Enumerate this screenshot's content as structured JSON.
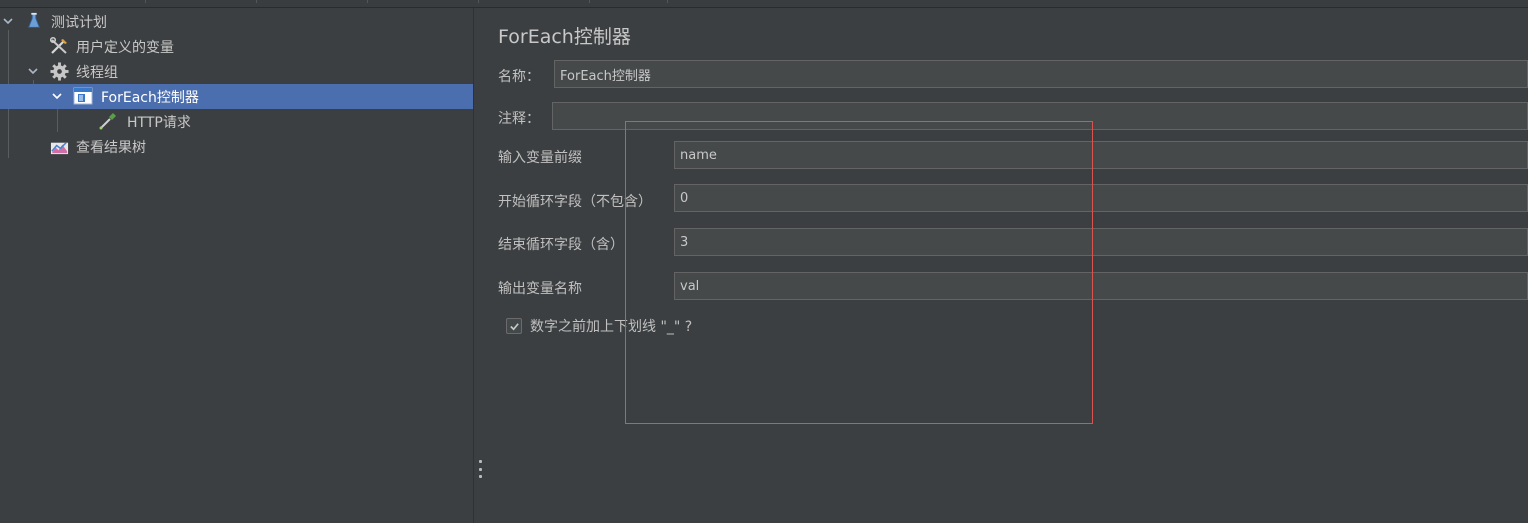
{
  "tree": {
    "items": [
      {
        "label": "测试计划",
        "icon": "flask-icon",
        "expanded": true
      },
      {
        "label": "用户定义的变量",
        "icon": "tools-icon"
      },
      {
        "label": "线程组",
        "icon": "gear-icon",
        "expanded": true
      },
      {
        "label": "ForEach控制器",
        "icon": "controller-icon",
        "expanded": true,
        "selected": true
      },
      {
        "label": "HTTP请求",
        "icon": "pipette-icon"
      },
      {
        "label": "查看结果树",
        "icon": "chart-icon"
      }
    ]
  },
  "panel": {
    "title": "ForEach控制器",
    "name_label": "名称：",
    "name_value": "ForEach控制器",
    "comment_label": "注释：",
    "comment_value": "",
    "input_prefix_label": "输入变量前缀",
    "input_prefix_value": "name",
    "start_index_label": "开始循环字段（不包含）",
    "start_index_value": "0",
    "end_index_label": "结束循环字段（含）",
    "end_index_value": "3",
    "output_var_label": "输出变量名称",
    "output_var_value": "val",
    "underscore_label": "数字之前加上下划线 \"_\" ?",
    "underscore_checked": true
  },
  "colors": {
    "background": "#3c3f41",
    "selection": "#4b6eaf",
    "field_bg": "#45494a",
    "highlight_box": "#d9534f"
  }
}
